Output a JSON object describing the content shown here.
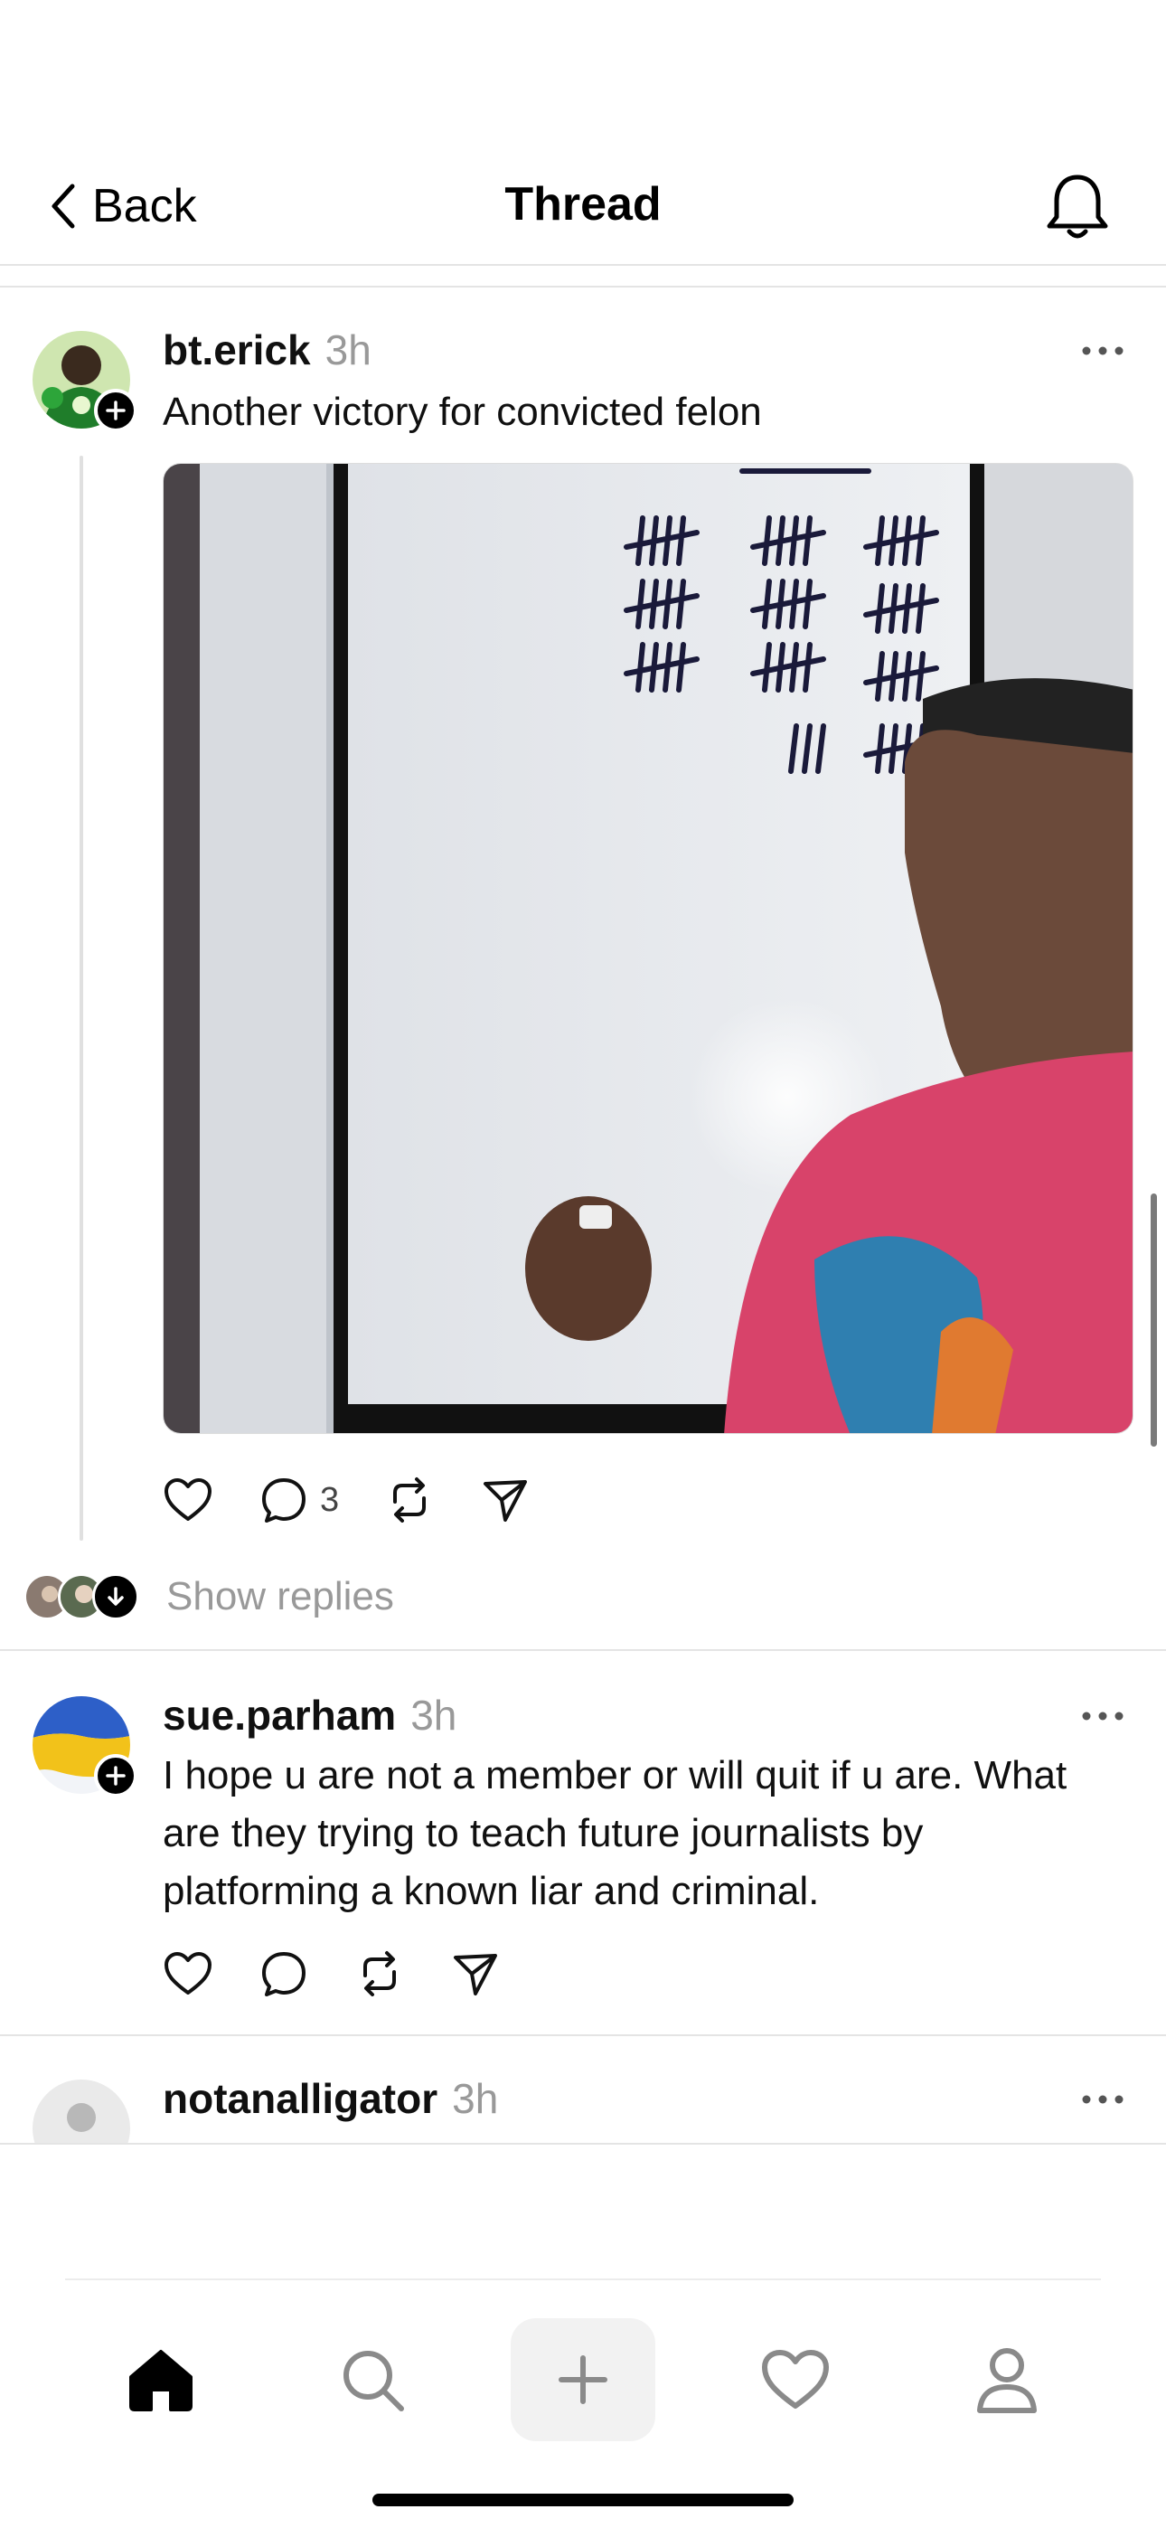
{
  "header": {
    "back_label": "Back",
    "title": "Thread"
  },
  "posts": [
    {
      "username": "bt.erick",
      "time": "3h",
      "text": "Another victory for convicted felon",
      "replies_count": "3",
      "show_replies_label": "Show replies"
    },
    {
      "username": "sue.parham",
      "time": "3h",
      "text": "I hope u are not a member or will quit if u are. What are they trying to teach future journalists by platforming a known liar and criminal."
    },
    {
      "username": "notanalligator",
      "time": "3h"
    }
  ],
  "tabs": [
    "home-icon",
    "search-icon",
    "compose-icon",
    "heart-icon",
    "profile-icon"
  ],
  "colors": {
    "muted": "#999999",
    "divider": "#e4e4e4",
    "text": "#101010"
  }
}
